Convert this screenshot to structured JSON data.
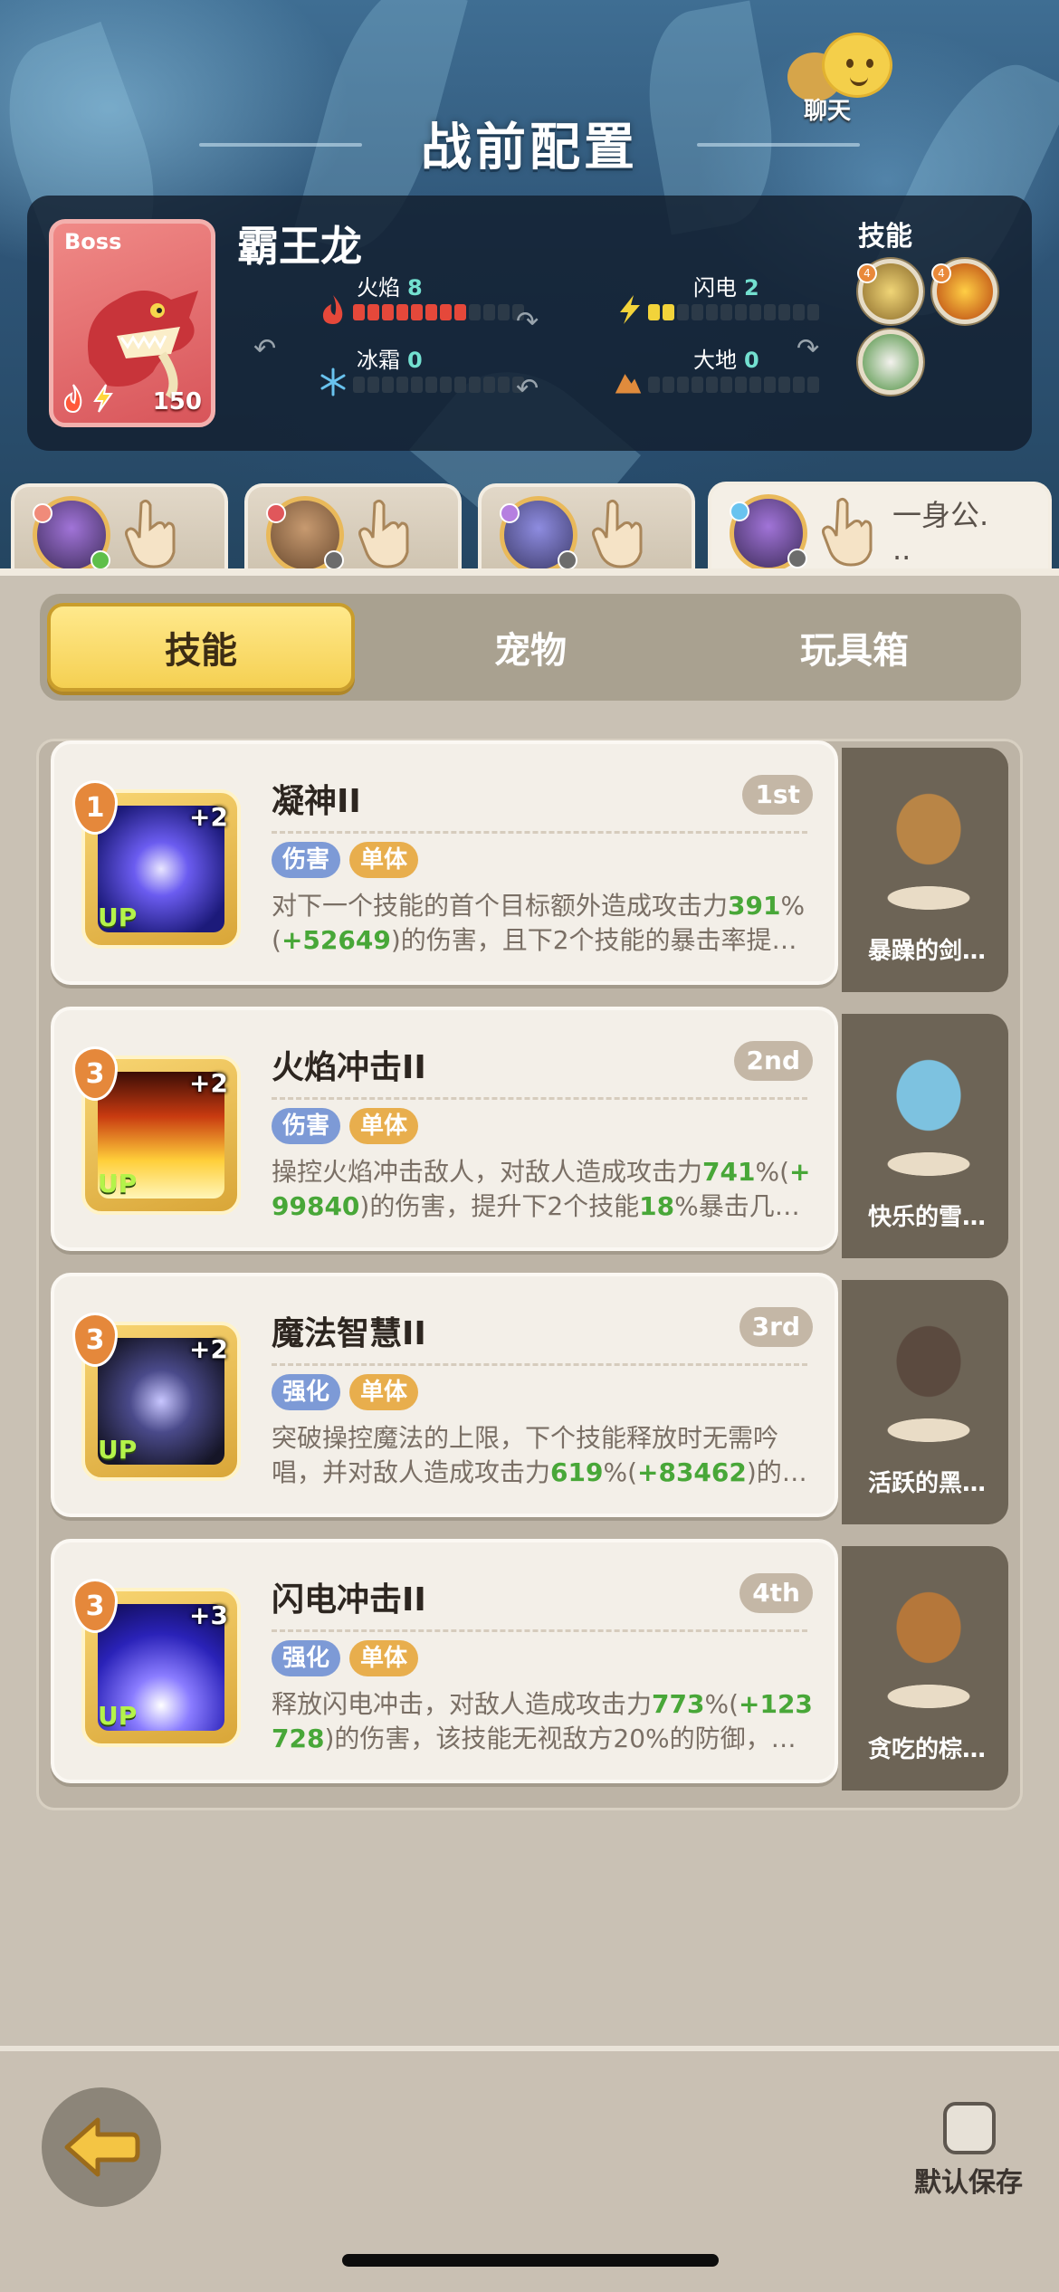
{
  "header": {
    "title": "战前配置",
    "chat_label": "聊天"
  },
  "boss": {
    "tag": "Boss",
    "name": "霸王龙",
    "level": "150",
    "elements": [
      {
        "label": "火焰",
        "value": "8",
        "filled": 8,
        "total": 12,
        "color": "#e5483a"
      },
      {
        "label": "闪电",
        "value": "2",
        "filled": 2,
        "total": 12,
        "color": "#f2d33a"
      },
      {
        "label": "冰霜",
        "value": "0",
        "filled": 0,
        "total": 12,
        "color": "#69c3ef"
      },
      {
        "label": "大地",
        "value": "0",
        "filled": 0,
        "total": 12,
        "color": "#e08b3c"
      }
    ],
    "skills_title": "技能"
  },
  "hero_tabs": [
    {
      "icon": "hero-avatar-catmask",
      "label": ""
    },
    {
      "icon": "hero-avatar-hamster",
      "label": ""
    },
    {
      "icon": "hero-avatar-penguin",
      "label": ""
    },
    {
      "icon": "hero-avatar-catmask",
      "label": "一身公.\n.."
    }
  ],
  "category_tabs": [
    "技能",
    "宠物",
    "玩具箱"
  ],
  "skills": [
    {
      "name": "凝神II",
      "order": "1st",
      "level": "1",
      "plus": "+2",
      "up": "UP",
      "tags": [
        "伤害",
        "单体"
      ],
      "desc_parts": [
        {
          "text": "对下一个技能的首个目标额外造成攻击力",
          "hl": false
        },
        {
          "text": "391",
          "hl": true
        },
        {
          "text": "%(",
          "hl": false
        },
        {
          "text": "+52649",
          "hl": true
        },
        {
          "text": ")的伤害，且下2个技能的暴击率提…",
          "hl": false
        }
      ],
      "pet": "暴躁的剑…"
    },
    {
      "name": "火焰冲击II",
      "order": "2nd",
      "level": "3",
      "plus": "+2",
      "up": "UP",
      "tags": [
        "伤害",
        "单体"
      ],
      "desc_parts": [
        {
          "text": "操控火焰冲击敌人，对敌人造成攻击力",
          "hl": false
        },
        {
          "text": "741",
          "hl": true
        },
        {
          "text": "%(",
          "hl": false
        },
        {
          "text": "+99840",
          "hl": true
        },
        {
          "text": ")的伤害，提升下2个技能",
          "hl": false
        },
        {
          "text": "18",
          "hl": true
        },
        {
          "text": "%暴击几…",
          "hl": false
        }
      ],
      "pet": "快乐的雪…"
    },
    {
      "name": "魔法智慧II",
      "order": "3rd",
      "level": "3",
      "plus": "+2",
      "up": "UP",
      "tags": [
        "强化",
        "单体"
      ],
      "desc_parts": [
        {
          "text": "突破操控魔法的上限，下个技能释放时无需吟唱，并对敌人造成攻击力",
          "hl": false
        },
        {
          "text": "619",
          "hl": true
        },
        {
          "text": "%(",
          "hl": false
        },
        {
          "text": "+83462",
          "hl": true
        },
        {
          "text": ")的…",
          "hl": false
        }
      ],
      "pet": "活跃的黑…"
    },
    {
      "name": "闪电冲击II",
      "order": "4th",
      "level": "3",
      "plus": "+3",
      "up": "UP",
      "tags": [
        "强化",
        "单体"
      ],
      "desc_parts": [
        {
          "text": "释放闪电冲击，对敌人造成攻击力",
          "hl": false
        },
        {
          "text": "773",
          "hl": true
        },
        {
          "text": "%(",
          "hl": false
        },
        {
          "text": "+123728",
          "hl": true
        },
        {
          "text": ")的伤害，该技能无视敌方20%的防御，…",
          "hl": false
        }
      ],
      "pet": "贪吃的棕…"
    }
  ],
  "footer": {
    "save_label": "默认保存"
  }
}
